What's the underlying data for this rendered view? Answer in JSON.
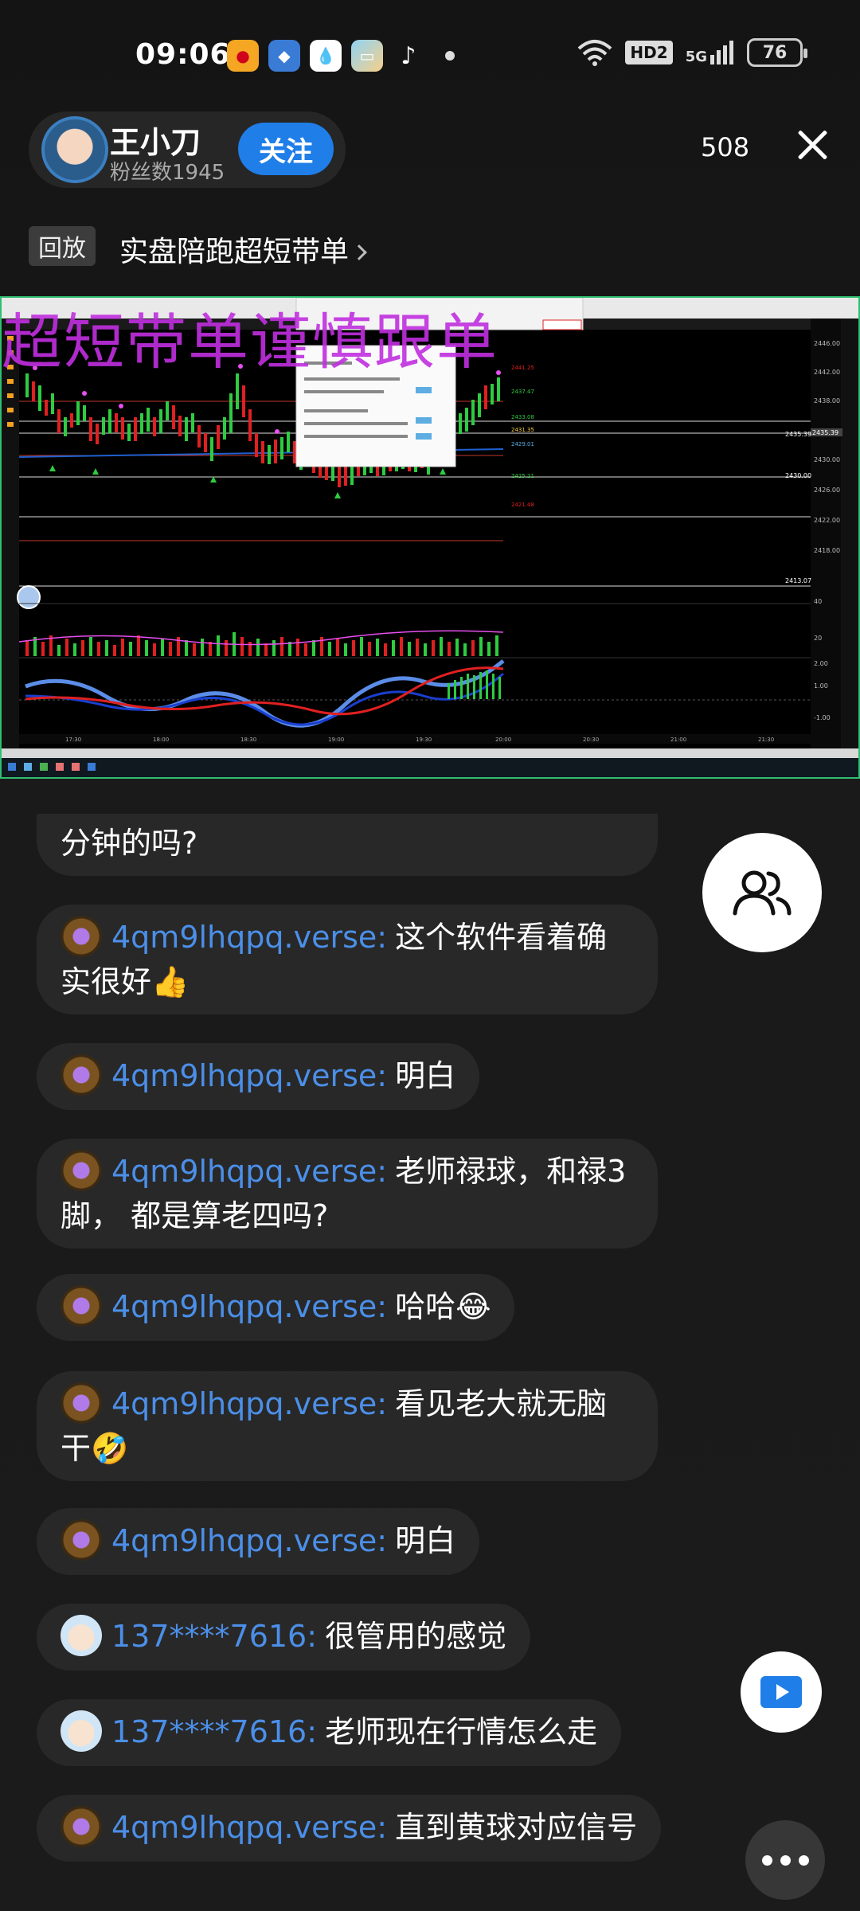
{
  "status_bar": {
    "time": "09:06",
    "battery": "76",
    "network": "5G",
    "hd": "HD2"
  },
  "host": {
    "name": "王小刀",
    "fans": "粉丝数1945",
    "follow_label": "关注"
  },
  "viewer_count": "508",
  "replay": {
    "tag": "回放",
    "title": "实盘陪跑超短带单"
  },
  "stream": {
    "overlay_text": "超短带单谨慎跟单",
    "chart_price_tags": [
      "2435.39",
      "2430.00",
      "2413.07"
    ],
    "popup_price_tag": "2429.01"
  },
  "chat": [
    {
      "user": "",
      "text": "分钟的吗?",
      "avatar": "verse-avatar"
    },
    {
      "user": "4qm9lhqpq.verse",
      "text": "这个软件看着确实很好👍",
      "avatar": "verse-avatar"
    },
    {
      "user": "4qm9lhqpq.verse",
      "text": "明白",
      "avatar": "verse-avatar"
    },
    {
      "user": "4qm9lhqpq.verse",
      "text": "老师禄球，和禄3脚， 都是算老四吗?",
      "avatar": "verse-avatar"
    },
    {
      "user": "4qm9lhqpq.verse",
      "text": "哈哈😂",
      "avatar": "verse-avatar"
    },
    {
      "user": "4qm9lhqpq.verse",
      "text": "看见老大就无脑干🤣",
      "avatar": "verse-avatar"
    },
    {
      "user": "4qm9lhqpq.verse",
      "text": "明白",
      "avatar": "verse-avatar"
    },
    {
      "user": "137****7616",
      "text": "很管用的感觉",
      "avatar": "baby-avatar"
    },
    {
      "user": "137****7616",
      "text": "老师现在行情怎么走",
      "avatar": "baby-avatar"
    },
    {
      "user": "4qm9lhqpq.verse",
      "text": "直到黄球对应信号",
      "avatar": "verse-avatar"
    }
  ],
  "colors": {
    "accent": "#1f7ee8",
    "username": "#4b8fe8",
    "overlay": "#c12fe0",
    "stream_border": "#2fbf71"
  }
}
